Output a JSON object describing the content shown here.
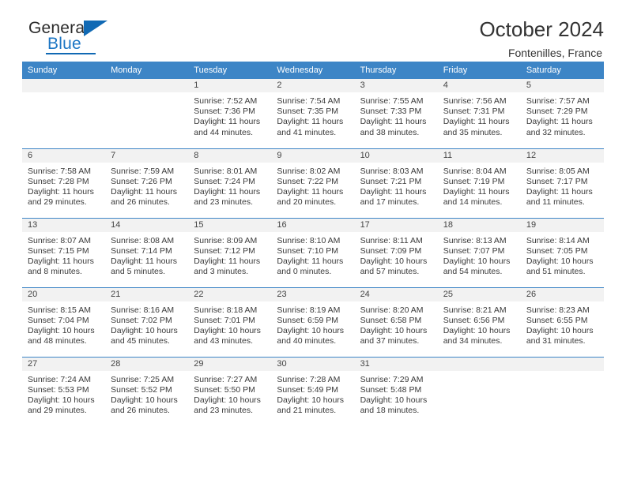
{
  "brand": {
    "name_top": "General",
    "name_bottom": "Blue",
    "accent_color": "#1069b4"
  },
  "header": {
    "title": "October 2024",
    "subtitle": "Fontenilles, France"
  },
  "theme": {
    "header_row_color": "#3d85c6",
    "day_number_band": "#f2f2f2",
    "text_color": "#333333"
  },
  "weekday_headers": [
    "Sunday",
    "Monday",
    "Tuesday",
    "Wednesday",
    "Thursday",
    "Friday",
    "Saturday"
  ],
  "labels": {
    "sunrise_prefix": "Sunrise:",
    "sunset_prefix": "Sunset:",
    "daylight_prefix": "Daylight:"
  },
  "weeks": [
    [
      {
        "day": "",
        "blank": true
      },
      {
        "day": "",
        "blank": true
      },
      {
        "day": "1",
        "sunrise": "Sunrise: 7:52 AM",
        "sunset": "Sunset: 7:36 PM",
        "daylight": "Daylight: 11 hours and 44 minutes."
      },
      {
        "day": "2",
        "sunrise": "Sunrise: 7:54 AM",
        "sunset": "Sunset: 7:35 PM",
        "daylight": "Daylight: 11 hours and 41 minutes."
      },
      {
        "day": "3",
        "sunrise": "Sunrise: 7:55 AM",
        "sunset": "Sunset: 7:33 PM",
        "daylight": "Daylight: 11 hours and 38 minutes."
      },
      {
        "day": "4",
        "sunrise": "Sunrise: 7:56 AM",
        "sunset": "Sunset: 7:31 PM",
        "daylight": "Daylight: 11 hours and 35 minutes."
      },
      {
        "day": "5",
        "sunrise": "Sunrise: 7:57 AM",
        "sunset": "Sunset: 7:29 PM",
        "daylight": "Daylight: 11 hours and 32 minutes."
      }
    ],
    [
      {
        "day": "6",
        "sunrise": "Sunrise: 7:58 AM",
        "sunset": "Sunset: 7:28 PM",
        "daylight": "Daylight: 11 hours and 29 minutes."
      },
      {
        "day": "7",
        "sunrise": "Sunrise: 7:59 AM",
        "sunset": "Sunset: 7:26 PM",
        "daylight": "Daylight: 11 hours and 26 minutes."
      },
      {
        "day": "8",
        "sunrise": "Sunrise: 8:01 AM",
        "sunset": "Sunset: 7:24 PM",
        "daylight": "Daylight: 11 hours and 23 minutes."
      },
      {
        "day": "9",
        "sunrise": "Sunrise: 8:02 AM",
        "sunset": "Sunset: 7:22 PM",
        "daylight": "Daylight: 11 hours and 20 minutes."
      },
      {
        "day": "10",
        "sunrise": "Sunrise: 8:03 AM",
        "sunset": "Sunset: 7:21 PM",
        "daylight": "Daylight: 11 hours and 17 minutes."
      },
      {
        "day": "11",
        "sunrise": "Sunrise: 8:04 AM",
        "sunset": "Sunset: 7:19 PM",
        "daylight": "Daylight: 11 hours and 14 minutes."
      },
      {
        "day": "12",
        "sunrise": "Sunrise: 8:05 AM",
        "sunset": "Sunset: 7:17 PM",
        "daylight": "Daylight: 11 hours and 11 minutes."
      }
    ],
    [
      {
        "day": "13",
        "sunrise": "Sunrise: 8:07 AM",
        "sunset": "Sunset: 7:15 PM",
        "daylight": "Daylight: 11 hours and 8 minutes."
      },
      {
        "day": "14",
        "sunrise": "Sunrise: 8:08 AM",
        "sunset": "Sunset: 7:14 PM",
        "daylight": "Daylight: 11 hours and 5 minutes."
      },
      {
        "day": "15",
        "sunrise": "Sunrise: 8:09 AM",
        "sunset": "Sunset: 7:12 PM",
        "daylight": "Daylight: 11 hours and 3 minutes."
      },
      {
        "day": "16",
        "sunrise": "Sunrise: 8:10 AM",
        "sunset": "Sunset: 7:10 PM",
        "daylight": "Daylight: 11 hours and 0 minutes."
      },
      {
        "day": "17",
        "sunrise": "Sunrise: 8:11 AM",
        "sunset": "Sunset: 7:09 PM",
        "daylight": "Daylight: 10 hours and 57 minutes."
      },
      {
        "day": "18",
        "sunrise": "Sunrise: 8:13 AM",
        "sunset": "Sunset: 7:07 PM",
        "daylight": "Daylight: 10 hours and 54 minutes."
      },
      {
        "day": "19",
        "sunrise": "Sunrise: 8:14 AM",
        "sunset": "Sunset: 7:05 PM",
        "daylight": "Daylight: 10 hours and 51 minutes."
      }
    ],
    [
      {
        "day": "20",
        "sunrise": "Sunrise: 8:15 AM",
        "sunset": "Sunset: 7:04 PM",
        "daylight": "Daylight: 10 hours and 48 minutes."
      },
      {
        "day": "21",
        "sunrise": "Sunrise: 8:16 AM",
        "sunset": "Sunset: 7:02 PM",
        "daylight": "Daylight: 10 hours and 45 minutes."
      },
      {
        "day": "22",
        "sunrise": "Sunrise: 8:18 AM",
        "sunset": "Sunset: 7:01 PM",
        "daylight": "Daylight: 10 hours and 43 minutes."
      },
      {
        "day": "23",
        "sunrise": "Sunrise: 8:19 AM",
        "sunset": "Sunset: 6:59 PM",
        "daylight": "Daylight: 10 hours and 40 minutes."
      },
      {
        "day": "24",
        "sunrise": "Sunrise: 8:20 AM",
        "sunset": "Sunset: 6:58 PM",
        "daylight": "Daylight: 10 hours and 37 minutes."
      },
      {
        "day": "25",
        "sunrise": "Sunrise: 8:21 AM",
        "sunset": "Sunset: 6:56 PM",
        "daylight": "Daylight: 10 hours and 34 minutes."
      },
      {
        "day": "26",
        "sunrise": "Sunrise: 8:23 AM",
        "sunset": "Sunset: 6:55 PM",
        "daylight": "Daylight: 10 hours and 31 minutes."
      }
    ],
    [
      {
        "day": "27",
        "sunrise": "Sunrise: 7:24 AM",
        "sunset": "Sunset: 5:53 PM",
        "daylight": "Daylight: 10 hours and 29 minutes."
      },
      {
        "day": "28",
        "sunrise": "Sunrise: 7:25 AM",
        "sunset": "Sunset: 5:52 PM",
        "daylight": "Daylight: 10 hours and 26 minutes."
      },
      {
        "day": "29",
        "sunrise": "Sunrise: 7:27 AM",
        "sunset": "Sunset: 5:50 PM",
        "daylight": "Daylight: 10 hours and 23 minutes."
      },
      {
        "day": "30",
        "sunrise": "Sunrise: 7:28 AM",
        "sunset": "Sunset: 5:49 PM",
        "daylight": "Daylight: 10 hours and 21 minutes."
      },
      {
        "day": "31",
        "sunrise": "Sunrise: 7:29 AM",
        "sunset": "Sunset: 5:48 PM",
        "daylight": "Daylight: 10 hours and 18 minutes."
      },
      {
        "day": "",
        "blank": true
      },
      {
        "day": "",
        "blank": true
      }
    ]
  ]
}
